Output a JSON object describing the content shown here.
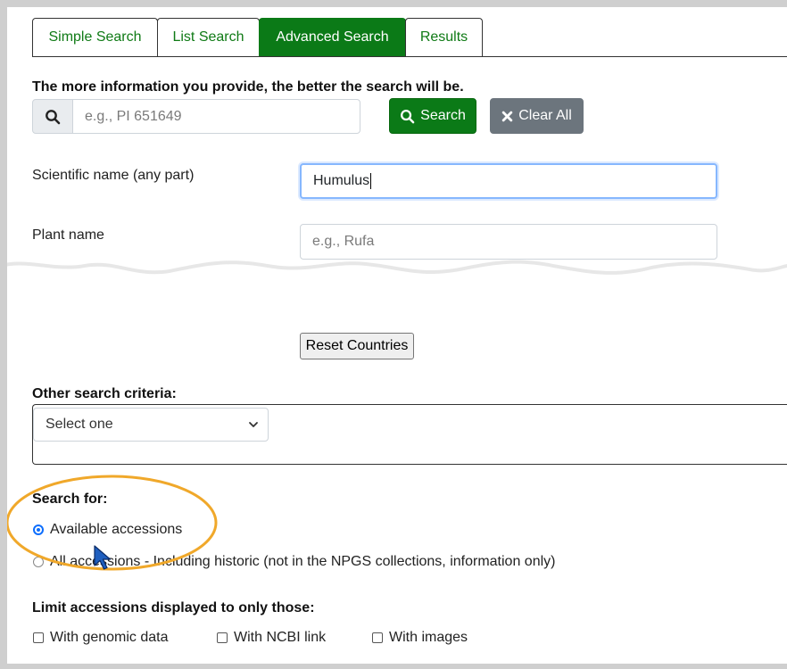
{
  "tabs": [
    {
      "label": "Simple Search",
      "active": false
    },
    {
      "label": "List Search",
      "active": false
    },
    {
      "label": "Advanced Search",
      "active": true
    },
    {
      "label": "Results",
      "active": false
    }
  ],
  "intro_text": "The more information you provide, the better the search will be.",
  "quick_search": {
    "placeholder": "e.g., PI 651649",
    "value": "",
    "icon": "search-icon"
  },
  "buttons": {
    "search_label": "Search",
    "clear_label": "Clear All",
    "reset_countries_label": "Reset Countries"
  },
  "fields": {
    "scientific_name": {
      "label": "Scientific name (any part)",
      "value": "Humulus"
    },
    "plant_name": {
      "label": "Plant name",
      "placeholder": "e.g., Rufa",
      "value": ""
    }
  },
  "other_criteria": {
    "label": "Other search criteria:",
    "selected": "Select one"
  },
  "search_for": {
    "label": "Search for:",
    "options": [
      {
        "label": "Available accessions",
        "checked": true
      },
      {
        "label": "All accessions - Including historic (not in the NPGS collections, information only)",
        "checked": false
      }
    ]
  },
  "limit": {
    "label": "Limit accessions displayed to only those:",
    "options": [
      {
        "label": "With genomic data",
        "checked": false
      },
      {
        "label": "With NCBI link",
        "checked": false
      },
      {
        "label": "With images",
        "checked": false
      }
    ]
  },
  "colors": {
    "primary_green": "#0b7a17",
    "tab_text_green": "#0f7a15",
    "secondary_gray": "#6c757d",
    "highlight_orange": "#f0a82a",
    "radio_blue": "#0d6efd"
  }
}
